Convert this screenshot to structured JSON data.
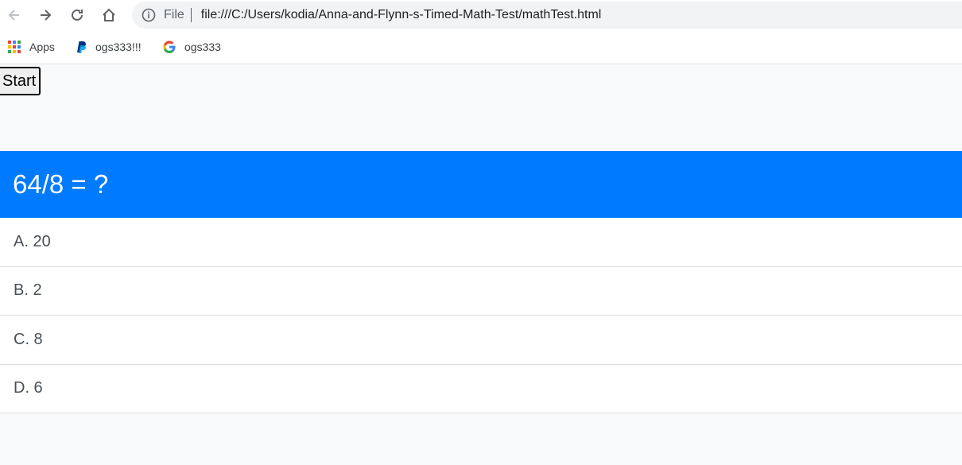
{
  "browser": {
    "address_scheme": "File",
    "address_url": "file:///C:/Users/kodia/Anna-and-Flynn-s-Timed-Math-Test/mathTest.html",
    "bookmarks": [
      {
        "label": "Apps",
        "icon": "apps-grid-icon"
      },
      {
        "label": "ogs333!!!",
        "icon": "paypal-icon"
      },
      {
        "label": "ogs333",
        "icon": "google-icon"
      }
    ]
  },
  "page": {
    "start_label": "Start",
    "question": "64/8 = ?",
    "answers": [
      "A. 20",
      "B. 2",
      "C. 8",
      "D. 6"
    ]
  },
  "colors": {
    "header_blue": "#007bff",
    "page_bg": "#f8f9fa"
  }
}
